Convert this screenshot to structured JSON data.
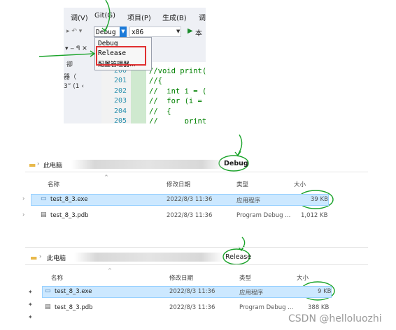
{
  "vs": {
    "menu": [
      "调(V)",
      "Git(G)",
      "项目(P)",
      "生成(B)",
      "调"
    ],
    "config_selected": "Debug",
    "platform_selected": "x86",
    "run_label": "本",
    "config_options": [
      "Debug",
      "Release",
      "配置管理器..."
    ],
    "left_pane": [
      "▾ ‒ ꟼ ✕",
      "卻",
      "器（",
      "3” (1 ‹"
    ],
    "line_numbers": [
      "200",
      "201",
      "202",
      "203",
      "204",
      "205"
    ],
    "code_lines": [
      "//void print(",
      "//{",
      "//  int i = (",
      "//  for (i = ",
      "//  {",
      "//      print"
    ]
  },
  "debug_explorer": {
    "breadcrumb_root": "此电脑",
    "folder": "Debug",
    "columns": [
      "名称",
      "修改日期",
      "类型",
      "大小"
    ],
    "files": [
      {
        "name": "test_8_3.exe",
        "date": "2022/8/3 11:36",
        "type": "应用程序",
        "size": "39 KB"
      },
      {
        "name": "test_8_3.pdb",
        "date": "2022/8/3 11:36",
        "type": "Program Debug ...",
        "size": "1,012 KB"
      }
    ]
  },
  "release_explorer": {
    "breadcrumb_root": "此电脑",
    "folder": "Release",
    "columns": [
      "名称",
      "修改日期",
      "类型",
      "大小"
    ],
    "files": [
      {
        "name": "test_8_3.exe",
        "date": "2022/8/3 11:36",
        "type": "应用程序",
        "size": "9 KB"
      },
      {
        "name": "test_8_3.pdb",
        "date": "2022/8/3 11:36",
        "type": "Program Debug ...",
        "size": "388 KB"
      }
    ]
  },
  "watermark": "CSDN @helloluozhi",
  "colors": {
    "annotation_green": "#1aa32a",
    "highlight_red": "#e03030",
    "selection_blue": "#cce8ff"
  }
}
